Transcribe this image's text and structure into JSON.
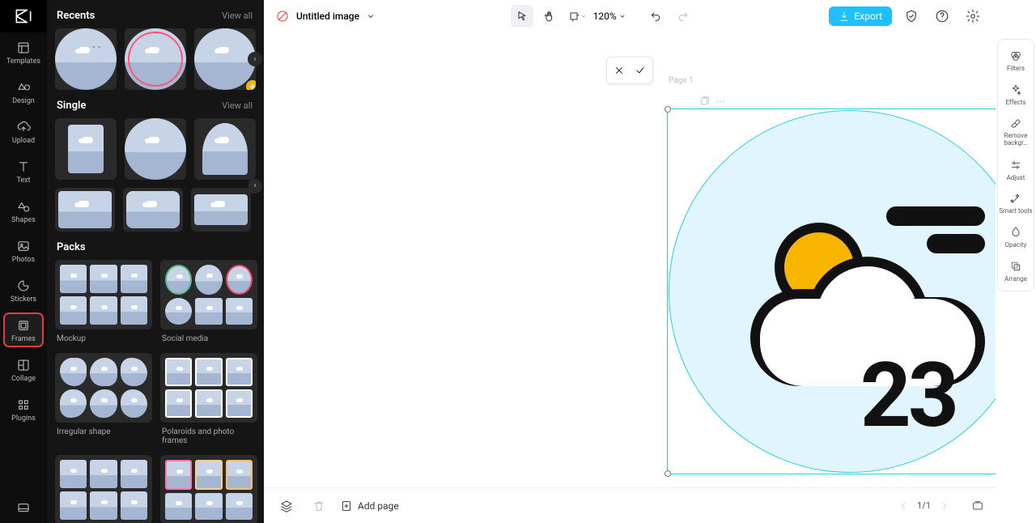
{
  "nav": {
    "items": [
      {
        "label": "Templates"
      },
      {
        "label": "Design"
      },
      {
        "label": "Upload"
      },
      {
        "label": "Text"
      },
      {
        "label": "Shapes"
      },
      {
        "label": "Photos"
      },
      {
        "label": "Stickers"
      },
      {
        "label": "Frames"
      },
      {
        "label": "Collage"
      },
      {
        "label": "Plugins"
      }
    ]
  },
  "panel": {
    "recents": {
      "title": "Recents",
      "viewall": "View all"
    },
    "single": {
      "title": "Single",
      "viewall": "View all"
    },
    "packs": {
      "title": "Packs",
      "items": [
        {
          "label": "Mockup"
        },
        {
          "label": "Social media"
        },
        {
          "label": "Irregular shape"
        },
        {
          "label": "Polaroids and photo frames"
        }
      ]
    }
  },
  "topbar": {
    "title": "Untitled image",
    "zoom": "120%",
    "export": "Export"
  },
  "canvas": {
    "page_label": "Page 1",
    "temperature": "23"
  },
  "bottombar": {
    "add_page": "Add page",
    "page_counter": "1/1"
  },
  "rightRail": {
    "items": [
      {
        "label": "Filters"
      },
      {
        "label": "Effects"
      },
      {
        "label": "Remove backgr…"
      },
      {
        "label": "Adjust"
      },
      {
        "label": "Smart tools"
      },
      {
        "label": "Opacity"
      },
      {
        "label": "Arrange"
      }
    ]
  }
}
